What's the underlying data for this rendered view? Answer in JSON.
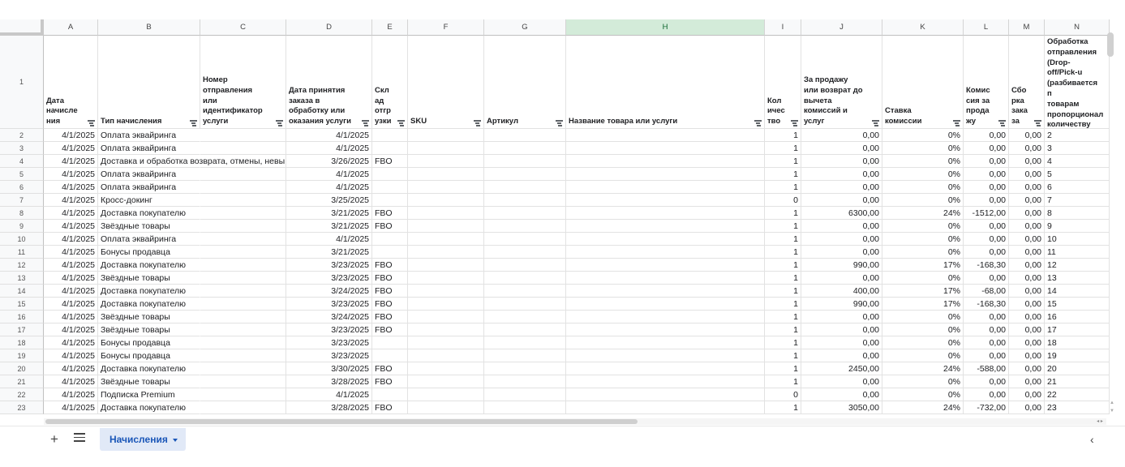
{
  "columns": [
    "A",
    "B",
    "C",
    "D",
    "E",
    "F",
    "G",
    "H",
    "I",
    "J",
    "K",
    "L",
    "M",
    "N"
  ],
  "selected_column": "H",
  "header_row_number": "1",
  "headers": [
    "Дата\nначисле\nния",
    "Тип начисления",
    "Номер\nотправления\nили\nидентификатор\nуслуги",
    "Дата принятия\nзаказа в\nобработку или\nоказания услуги",
    "Скл\nад\nотгр\nузки",
    "SKU",
    "Артикул",
    "Название товара или услуги",
    "Кол\nичес\nтво",
    "За продажу\nили возврат до\nвычета\nкомиссий и\nуслуг",
    "Ставка\nкомиссии",
    "Комис\nсия за\nпрода\nжу",
    "Сбо\nрка\nзака\nза",
    "Обработка\nотправления\n(Drop-off/Pick-u\n(разбивается п\nтоварам\nпропорционал\nколичеству в\nотправлении)"
  ],
  "rows": [
    {
      "n": "2",
      "a": "4/1/2025",
      "b": "Оплата эквайринга",
      "d": "4/1/2025",
      "e": "",
      "i": "1",
      "j": "0,00",
      "k": "0%",
      "l": "0,00",
      "m": "0,00"
    },
    {
      "n": "3",
      "a": "4/1/2025",
      "b": "Оплата эквайринга",
      "d": "4/1/2025",
      "e": "",
      "i": "1",
      "j": "0,00",
      "k": "0%",
      "l": "0,00",
      "m": "0,00"
    },
    {
      "n": "4",
      "a": "4/1/2025",
      "b": "Доставка и обработка возврата, отмены, невы",
      "d": "3/26/2025",
      "e": "FBO",
      "i": "1",
      "j": "0,00",
      "k": "0%",
      "l": "0,00",
      "m": "0,00"
    },
    {
      "n": "5",
      "a": "4/1/2025",
      "b": "Оплата эквайринга",
      "d": "4/1/2025",
      "e": "",
      "i": "1",
      "j": "0,00",
      "k": "0%",
      "l": "0,00",
      "m": "0,00"
    },
    {
      "n": "6",
      "a": "4/1/2025",
      "b": "Оплата эквайринга",
      "d": "4/1/2025",
      "e": "",
      "i": "1",
      "j": "0,00",
      "k": "0%",
      "l": "0,00",
      "m": "0,00"
    },
    {
      "n": "7",
      "a": "4/1/2025",
      "b": "Кросс-докинг",
      "d": "3/25/2025",
      "e": "",
      "i": "0",
      "j": "0,00",
      "k": "0%",
      "l": "0,00",
      "m": "0,00"
    },
    {
      "n": "8",
      "a": "4/1/2025",
      "b": "Доставка покупателю",
      "d": "3/21/2025",
      "e": "FBO",
      "i": "1",
      "j": "6300,00",
      "k": "24%",
      "l": "-1512,00",
      "m": "0,00"
    },
    {
      "n": "9",
      "a": "4/1/2025",
      "b": "Звёздные товары",
      "d": "3/21/2025",
      "e": "FBO",
      "i": "1",
      "j": "0,00",
      "k": "0%",
      "l": "0,00",
      "m": "0,00"
    },
    {
      "n": "10",
      "a": "4/1/2025",
      "b": "Оплата эквайринга",
      "d": "4/1/2025",
      "e": "",
      "i": "1",
      "j": "0,00",
      "k": "0%",
      "l": "0,00",
      "m": "0,00"
    },
    {
      "n": "11",
      "a": "4/1/2025",
      "b": "Бонусы продавца",
      "d": "3/21/2025",
      "e": "",
      "i": "1",
      "j": "0,00",
      "k": "0%",
      "l": "0,00",
      "m": "0,00"
    },
    {
      "n": "12",
      "a": "4/1/2025",
      "b": "Доставка покупателю",
      "d": "3/23/2025",
      "e": "FBO",
      "i": "1",
      "j": "990,00",
      "k": "17%",
      "l": "-168,30",
      "m": "0,00"
    },
    {
      "n": "13",
      "a": "4/1/2025",
      "b": "Звёздные товары",
      "d": "3/23/2025",
      "e": "FBO",
      "i": "1",
      "j": "0,00",
      "k": "0%",
      "l": "0,00",
      "m": "0,00"
    },
    {
      "n": "14",
      "a": "4/1/2025",
      "b": "Доставка покупателю",
      "d": "3/24/2025",
      "e": "FBO",
      "i": "1",
      "j": "400,00",
      "k": "17%",
      "l": "-68,00",
      "m": "0,00"
    },
    {
      "n": "15",
      "a": "4/1/2025",
      "b": "Доставка покупателю",
      "d": "3/23/2025",
      "e": "FBO",
      "i": "1",
      "j": "990,00",
      "k": "17%",
      "l": "-168,30",
      "m": "0,00"
    },
    {
      "n": "16",
      "a": "4/1/2025",
      "b": "Звёздные товары",
      "d": "3/24/2025",
      "e": "FBO",
      "i": "1",
      "j": "0,00",
      "k": "0%",
      "l": "0,00",
      "m": "0,00"
    },
    {
      "n": "17",
      "a": "4/1/2025",
      "b": "Звёздные товары",
      "d": "3/23/2025",
      "e": "FBO",
      "i": "1",
      "j": "0,00",
      "k": "0%",
      "l": "0,00",
      "m": "0,00"
    },
    {
      "n": "18",
      "a": "4/1/2025",
      "b": "Бонусы продавца",
      "d": "3/23/2025",
      "e": "",
      "i": "1",
      "j": "0,00",
      "k": "0%",
      "l": "0,00",
      "m": "0,00"
    },
    {
      "n": "19",
      "a": "4/1/2025",
      "b": "Бонусы продавца",
      "d": "3/23/2025",
      "e": "",
      "i": "1",
      "j": "0,00",
      "k": "0%",
      "l": "0,00",
      "m": "0,00"
    },
    {
      "n": "20",
      "a": "4/1/2025",
      "b": "Доставка покупателю",
      "d": "3/30/2025",
      "e": "FBO",
      "i": "1",
      "j": "2450,00",
      "k": "24%",
      "l": "-588,00",
      "m": "0,00"
    },
    {
      "n": "21",
      "a": "4/1/2025",
      "b": "Звёздные товары",
      "d": "3/28/2025",
      "e": "FBO",
      "i": "1",
      "j": "0,00",
      "k": "0%",
      "l": "0,00",
      "m": "0,00"
    },
    {
      "n": "22",
      "a": "4/1/2025",
      "b": "Подписка Premium",
      "d": "4/1/2025",
      "e": "",
      "i": "0",
      "j": "0,00",
      "k": "0%",
      "l": "0,00",
      "m": "0,00"
    },
    {
      "n": "23",
      "a": "4/1/2025",
      "b": "Доставка покупателю",
      "d": "3/28/2025",
      "e": "FBO",
      "i": "1",
      "j": "3050,00",
      "k": "24%",
      "l": "-732,00",
      "m": "0,00"
    }
  ],
  "tabbar": {
    "add_icon": "+",
    "sheet_tab_label": "Начисления",
    "explore_icon": "‹"
  },
  "icons": {
    "filter": "filter-icon",
    "add_sheet": "plus-icon",
    "all_sheets": "menu-icon",
    "sheet_menu": "caret-down-icon",
    "side_panel": "chevron-left-icon"
  },
  "colors": {
    "selected_column_header": "#d3ebd9",
    "active_tab_bg": "#e1e9f7",
    "active_tab_text": "#1a56b8"
  }
}
